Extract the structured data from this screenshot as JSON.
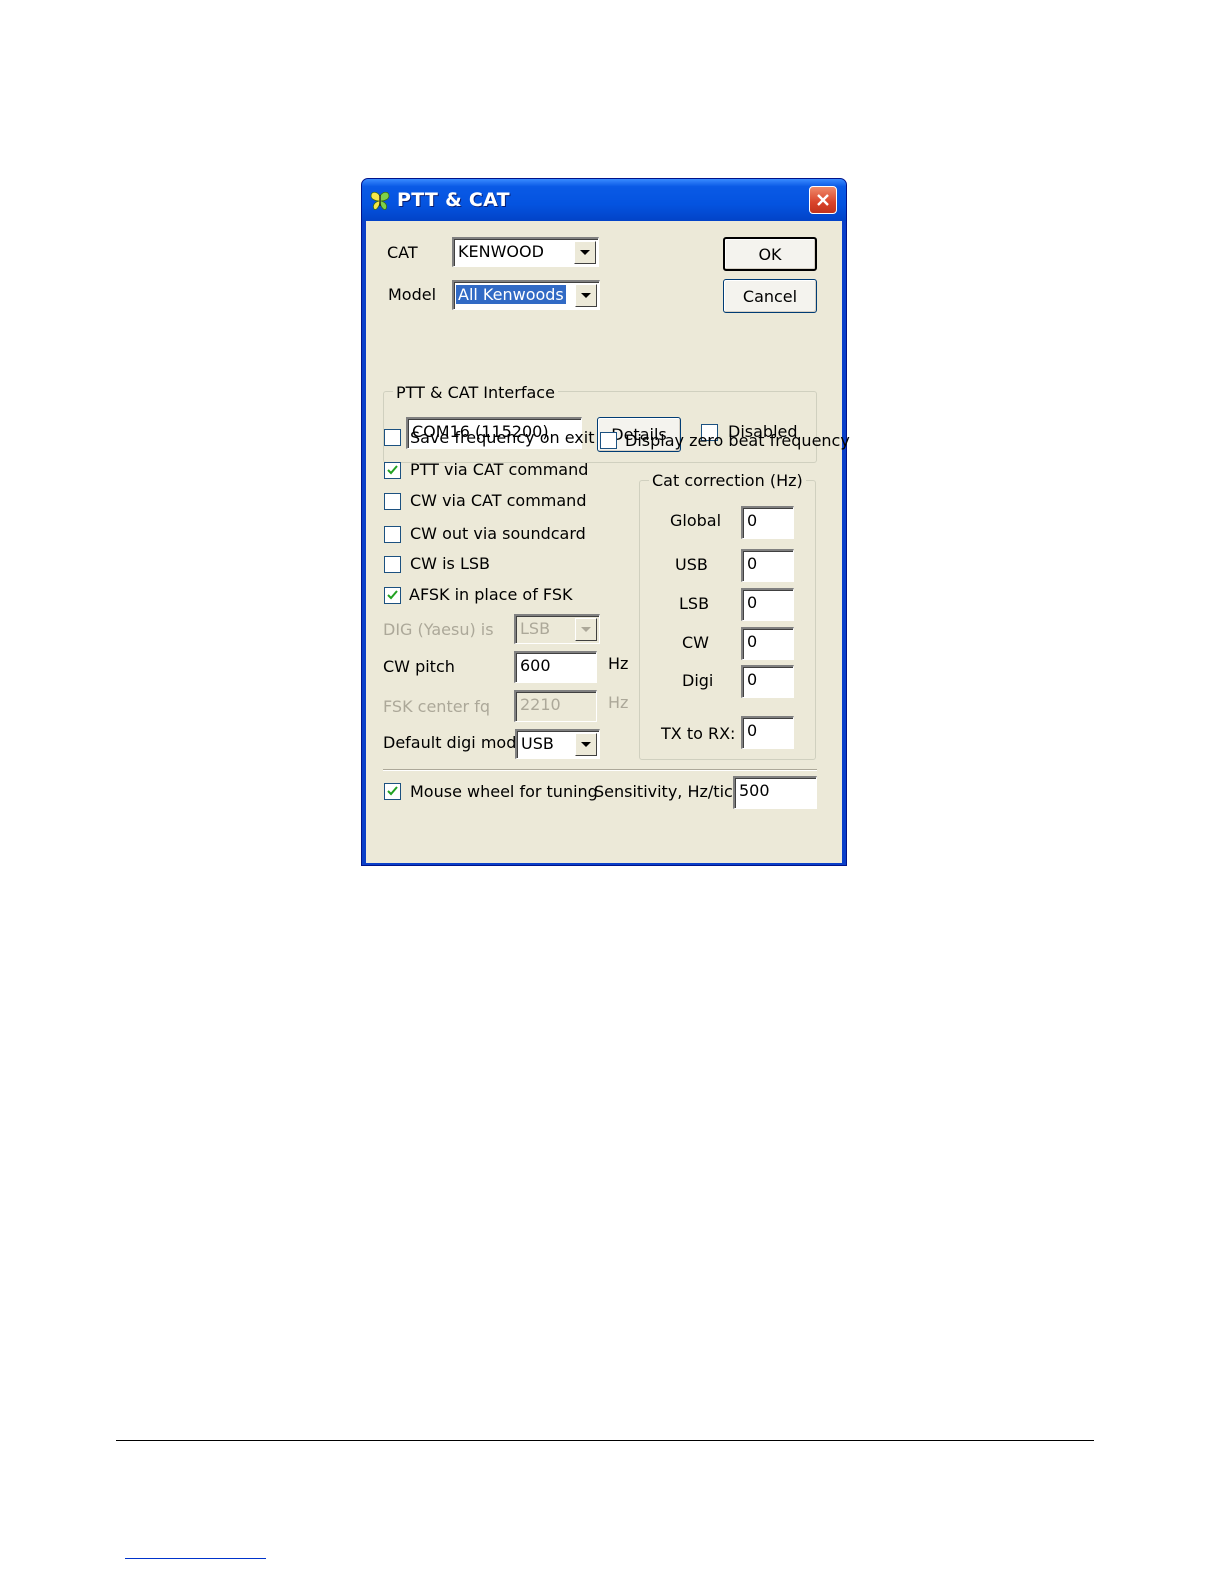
{
  "window": {
    "title": "PTT & CAT",
    "icon": "butterfly-app-icon"
  },
  "cat": {
    "label": "CAT",
    "value": "KENWOOD"
  },
  "model": {
    "label": "Model",
    "value": "All Kenwoods"
  },
  "buttons": {
    "ok": "OK",
    "cancel": "Cancel",
    "details": "Details"
  },
  "interface": {
    "legend": "PTT & CAT Interface",
    "port": "COM16 (115200)",
    "disabled_label": "Disabled",
    "disabled_checked": false
  },
  "options": {
    "save_frequency": {
      "label": "Save frequency on exit",
      "checked": false
    },
    "display_zero_beat": {
      "label": "Display zero beat frequency",
      "checked": false
    },
    "ptt_via_cat": {
      "label": "PTT via CAT command",
      "checked": true
    },
    "cw_via_cat": {
      "label": "CW via CAT command",
      "checked": false
    },
    "cw_out_soundcard": {
      "label": "CW out via soundcard",
      "checked": false
    },
    "cw_is_lsb": {
      "label": "CW is LSB",
      "checked": false
    },
    "afsk_in_place": {
      "label": "AFSK in place of FSK",
      "checked": true
    }
  },
  "dig_yaesu": {
    "label": "DIG (Yaesu) is",
    "value": "LSB"
  },
  "cw_pitch": {
    "label": "CW pitch",
    "value": "600",
    "unit": "Hz"
  },
  "fsk_center": {
    "label": "FSK center fq",
    "value": "2210",
    "unit": "Hz"
  },
  "default_digi": {
    "label": "Default digi mode",
    "value": "USB"
  },
  "correction": {
    "legend": "Cat correction (Hz)",
    "global": {
      "label": "Global",
      "value": "0"
    },
    "usb": {
      "label": "USB",
      "value": "0"
    },
    "lsb": {
      "label": "LSB",
      "value": "0"
    },
    "cw": {
      "label": "CW",
      "value": "0"
    },
    "digi": {
      "label": "Digi",
      "value": "0"
    },
    "tx_to_rx": {
      "label": "TX to RX:",
      "value": "0"
    }
  },
  "mouse_wheel": {
    "label": "Mouse wheel for tuning",
    "checked": true
  },
  "sensitivity": {
    "label": "Sensitivity, Hz/tick",
    "value": "500"
  }
}
